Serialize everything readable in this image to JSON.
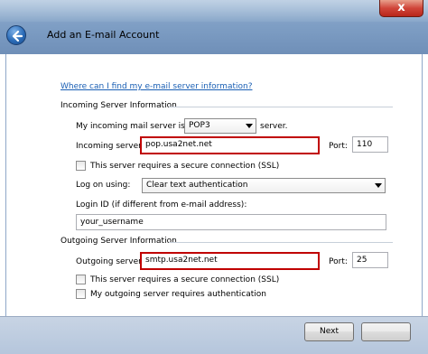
{
  "window": {
    "title": "Add an E-mail Account",
    "close_glyph": "x"
  },
  "help_link": "Where can I find my e-mail server information?",
  "incoming": {
    "section_title": "Incoming Server Information",
    "type_prefix": "My incoming mail server is a",
    "type_value": "POP3",
    "type_suffix": "server.",
    "server_label": "Incoming server:",
    "server_value": "pop.usa2net.net",
    "port_label": "Port:",
    "port_value": "110",
    "ssl_label": "This server requires a secure connection (SSL)",
    "ssl_checked": false,
    "logon_label": "Log on using:",
    "logon_value": "Clear text authentication",
    "login_id_label": "Login ID (if different from e-mail address):",
    "login_id_value": "your_username"
  },
  "outgoing": {
    "section_title": "Outgoing Server Information",
    "server_label": "Outgoing server:",
    "server_value": "smtp.usa2net.net",
    "port_label": "Port:",
    "port_value": "25",
    "ssl_label": "This server requires a secure connection (SSL)",
    "ssl_checked": false,
    "auth_label": "My outgoing server requires authentication",
    "auth_checked": false
  },
  "buttons": {
    "next_label": "Next"
  },
  "colors": {
    "highlight_border": "#c00000",
    "link": "#1a5fb4"
  },
  "icons": {
    "back": "back-arrow-icon",
    "close": "close-icon",
    "dropdown": "chevron-down-icon"
  }
}
